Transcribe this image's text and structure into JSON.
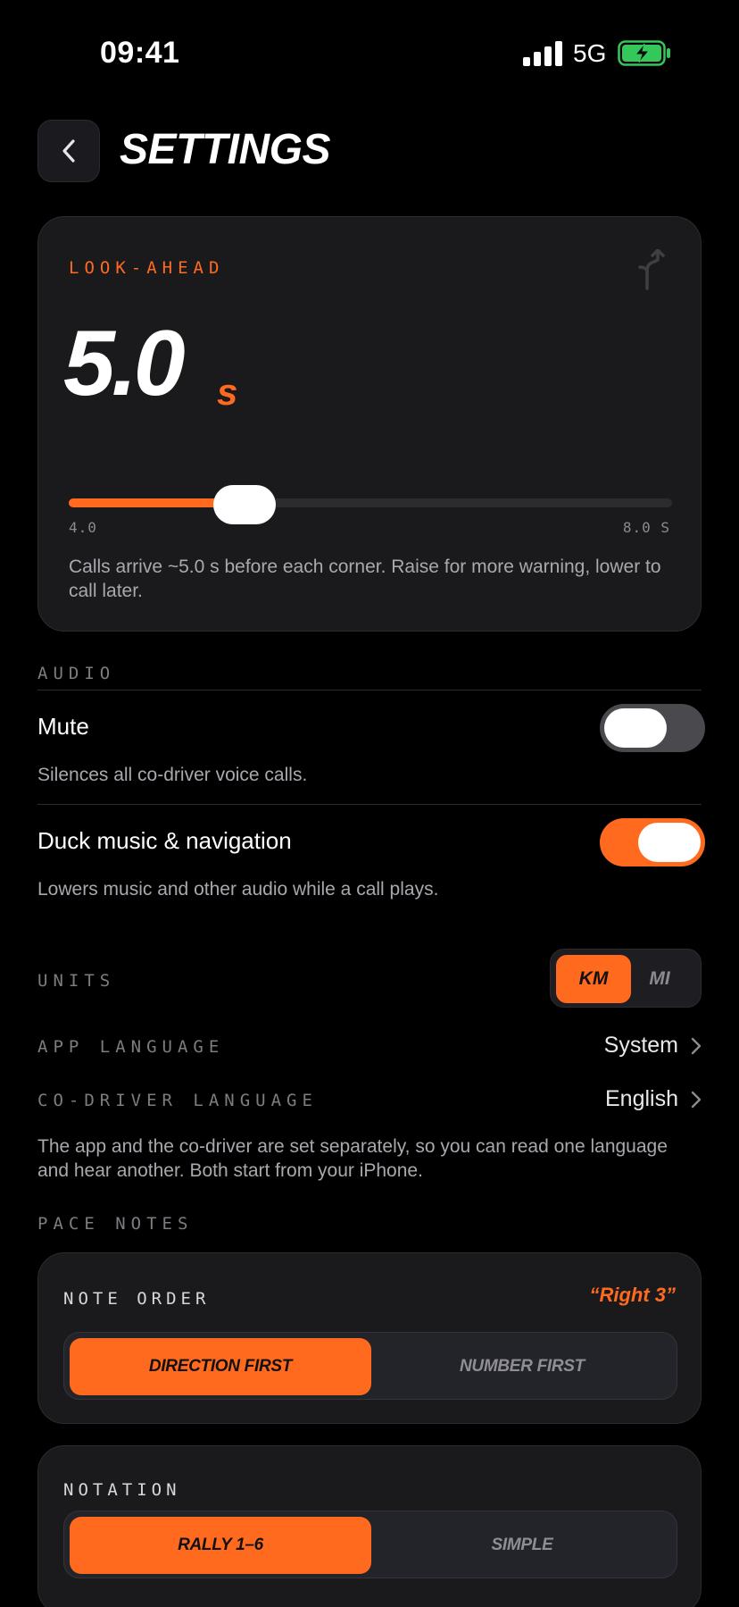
{
  "status_bar": {
    "time": "09:41",
    "network": "5G"
  },
  "header": {
    "title": "SETTINGS"
  },
  "look_ahead": {
    "label": "LOOK-AHEAD",
    "value": "5.0",
    "unit": "s",
    "slider": {
      "min_label": "4.0",
      "max_label": "8.0 S",
      "min": 4.0,
      "max": 8.0,
      "current": 5.0
    },
    "description": "Calls arrive ~5.0 s before each corner. Raise for more warning, lower to call later."
  },
  "audio": {
    "section_label": "AUDIO",
    "mute": {
      "title": "Mute",
      "description": "Silences all co-driver voice calls.",
      "enabled": false
    },
    "duck": {
      "title": "Duck music & navigation",
      "description": "Lowers music and other audio while a call plays.",
      "enabled": true
    }
  },
  "units": {
    "label": "UNITS",
    "options": [
      "KM",
      "MI"
    ],
    "selected": "KM"
  },
  "app_language": {
    "label": "APP LANGUAGE",
    "value": "System"
  },
  "codriver_language": {
    "label": "CO-DRIVER LANGUAGE",
    "value": "English"
  },
  "language_note": "The app and the co-driver are set separately, so you can read one language and hear another. Both start from your iPhone.",
  "pace_notes": {
    "section_label": "PACE NOTES",
    "note_order": {
      "label": "NOTE ORDER",
      "example": "“Right 3”",
      "options": [
        "DIRECTION FIRST",
        "NUMBER FIRST"
      ],
      "selected": "DIRECTION FIRST"
    },
    "notation": {
      "label": "NOTATION",
      "options": [
        "RALLY 1–6",
        "SIMPLE"
      ],
      "selected": "RALLY 1–6"
    }
  },
  "colors": {
    "accent": "#ff6a1f",
    "background": "#000000",
    "card": "#1a1a1d",
    "battery": "#34c759"
  },
  "icons": [
    "back-chevron-icon",
    "fork-arrow-icon",
    "chevron-right-icon",
    "signal-icon",
    "battery-charging-icon"
  ]
}
